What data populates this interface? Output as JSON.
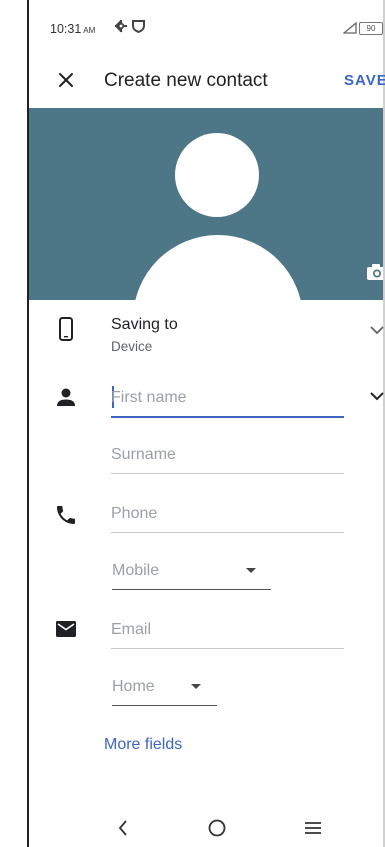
{
  "status_bar": {
    "time": "10:31",
    "ampm": "AM",
    "battery": "90"
  },
  "toolbar": {
    "title": "Create new contact",
    "save_label": "SAVE"
  },
  "account": {
    "label": "Saving to",
    "value": "Device"
  },
  "name": {
    "first_placeholder": "First name",
    "surname_placeholder": "Surname"
  },
  "phone": {
    "placeholder": "Phone",
    "type_selected": "Mobile"
  },
  "email": {
    "placeholder": "Email",
    "type_selected": "Home"
  },
  "more_fields_label": "More fields",
  "colors": {
    "accent": "#3b66c4",
    "header_bg": "#4d7786"
  },
  "icons": {
    "close": "close-icon",
    "camera": "camera-icon",
    "device": "phone-device-icon",
    "person": "person-icon",
    "phone": "phone-icon",
    "email": "email-icon"
  }
}
